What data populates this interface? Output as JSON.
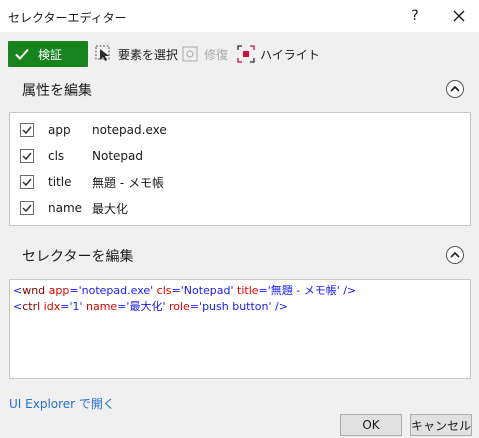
{
  "window": {
    "title": "セレクターエディター",
    "help_label": "?"
  },
  "toolbar": {
    "verify_label": "検証",
    "select_element_label": "要素を選択",
    "repair_label": "修復",
    "highlight_label": "ハイライト"
  },
  "attributes": {
    "header": "属性を編集",
    "rows": [
      {
        "checked": true,
        "name": "app",
        "value": "notepad.exe"
      },
      {
        "checked": true,
        "name": "cls",
        "value": "Notepad"
      },
      {
        "checked": true,
        "name": "title",
        "value": "無題 - メモ帳"
      },
      {
        "checked": true,
        "name": "name",
        "value": "最大化"
      }
    ]
  },
  "selector": {
    "header": "セレクターを編集",
    "lines": [
      {
        "open": "<",
        "tag": "wnd",
        "attrs": [
          {
            "name": "app",
            "value": "'notepad.exe'"
          },
          {
            "name": "cls",
            "value": "'Notepad'"
          },
          {
            "name": "title",
            "value": "'無題 - メモ帳'"
          }
        ],
        "close": "/>"
      },
      {
        "open": "<",
        "tag": "ctrl",
        "attrs": [
          {
            "name": "idx",
            "value": "'1'"
          },
          {
            "name": "name",
            "value": "'最大化'"
          },
          {
            "name": "role",
            "value": "'push button'"
          }
        ],
        "close": "/>"
      }
    ]
  },
  "footer": {
    "ui_explorer_link": "UI Explorer で開く",
    "ok_label": "OK",
    "cancel_label": "キャンセル"
  },
  "colors": {
    "verify_bg": "#17831d",
    "link": "#2a6fc9",
    "highlight_icon": "#d0103a"
  }
}
